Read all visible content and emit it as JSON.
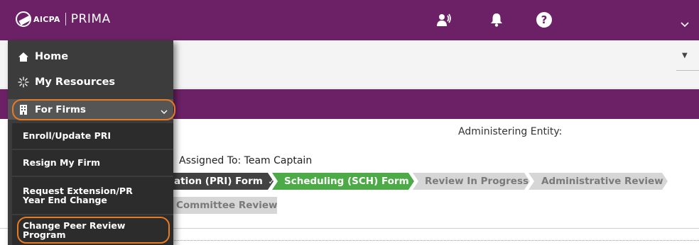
{
  "header": {
    "logo_aicpa": "AICPA",
    "logo_prima": "PRIMA",
    "icons": [
      "users-voice-icon",
      "bell-icon",
      "help-icon",
      "chevron-down-icon"
    ],
    "help_glyph": "?",
    "brand_color": "#6c2167"
  },
  "sidebar": {
    "items": [
      {
        "label": "Home",
        "icon": "home-icon"
      },
      {
        "label": "My Resources",
        "icon": "sparkle-icon"
      },
      {
        "label": "For Firms",
        "icon": "building-icon"
      }
    ],
    "for_firms_sub": [
      {
        "label": "Enroll/Update PRI"
      },
      {
        "label": "Resign My Firm"
      },
      {
        "label": "Request Extension/PR Year End Change"
      },
      {
        "label": "Change Peer Review Program"
      }
    ]
  },
  "subbar": {
    "caret": "▼"
  },
  "main": {
    "colon_fragment": ":",
    "administering_entity_label": "Administering Entity:",
    "assigned_to": "Assigned To: Team Captain",
    "steps": [
      {
        "label": "ation (PRI) Form",
        "status": "completed",
        "check": "✓",
        "color": "#424242"
      },
      {
        "label": "Scheduling (SCH) Form",
        "status": "current",
        "color": "#4cab47"
      },
      {
        "label": "Review In Progress",
        "status": "pending",
        "color": "#d6d6d6"
      },
      {
        "label": "Administrative Review",
        "status": "pending",
        "color": "#d6d6d6"
      },
      {
        "label": "Committee Review",
        "status": "pending",
        "color": "#d6d6d6"
      }
    ]
  },
  "highlight_color": "#e87a22"
}
